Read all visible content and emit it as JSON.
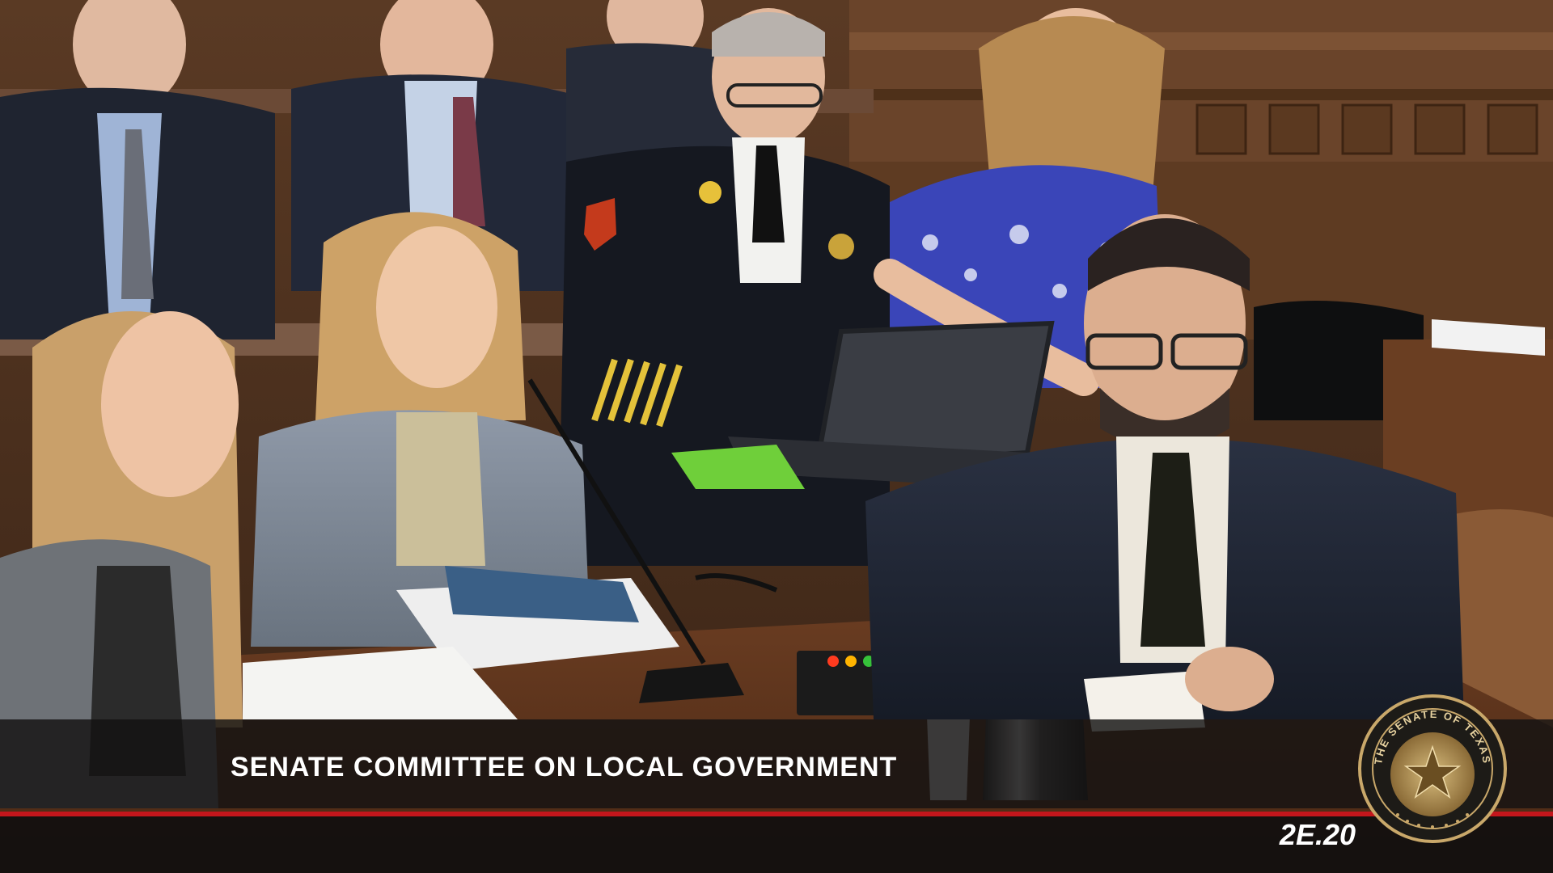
{
  "broadcast": {
    "caption_title": "SENATE COMMITTEE ON LOCAL GOVERNMENT",
    "bill_code": "2E.20",
    "seal_text": "THE SENATE OF TEXAS"
  },
  "colors": {
    "caption_band": "#141212",
    "accent_rule": "#c4161c",
    "seal_gold": "#b8955a",
    "seal_dark": "#1d1b17"
  },
  "scene": {
    "description_tags": [
      "hearing-room",
      "witness-table",
      "microphones",
      "laptop",
      "carafe"
    ],
    "timer_light_colors": [
      "#ff3b1f",
      "#ffb400",
      "#36c23a"
    ]
  }
}
